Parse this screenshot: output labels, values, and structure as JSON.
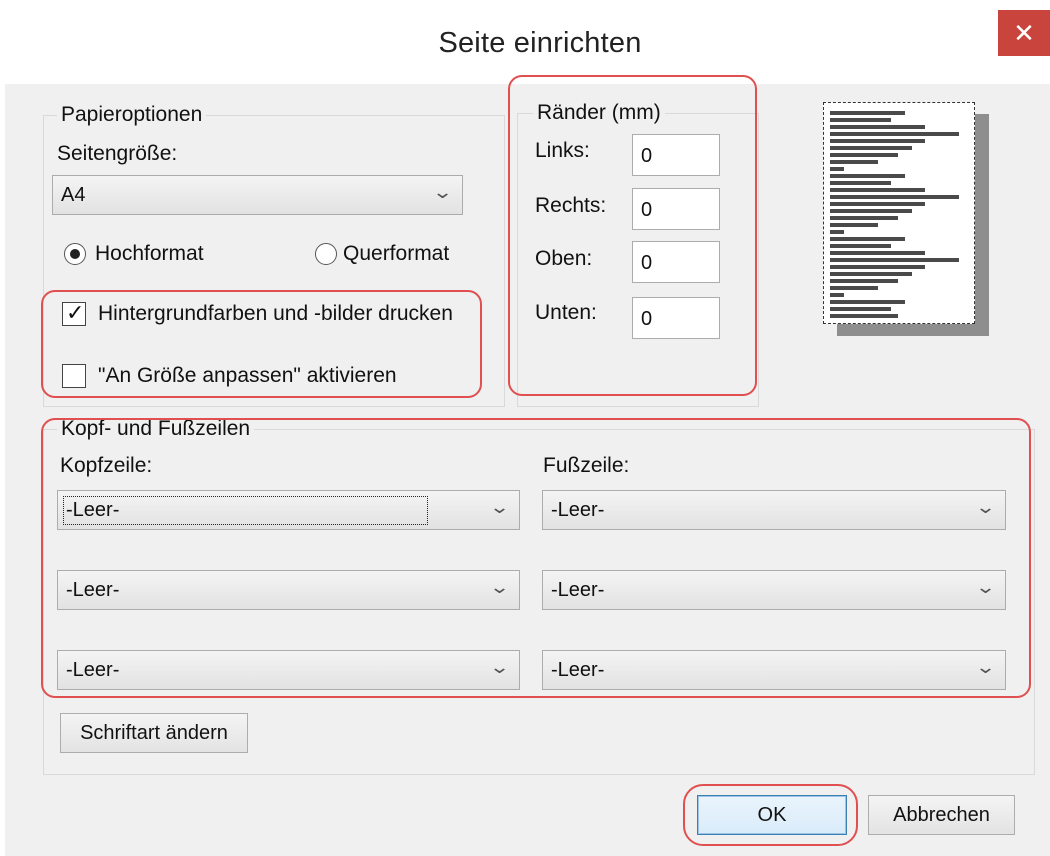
{
  "window": {
    "title": "Seite einrichten",
    "close_glyph": "✕"
  },
  "paper_options": {
    "legend": "Papieroptionen",
    "page_size_label": "Seitengröße:",
    "page_size_value": "A4",
    "portrait_label": "Hochformat",
    "landscape_label": "Querformat",
    "orientation_selected": "Hochformat",
    "print_background_label": "Hintergrundfarben und -bilder drucken",
    "print_background_checked": true,
    "shrink_to_fit_label": "\"An Größe anpassen\" aktivieren",
    "shrink_to_fit_checked": false
  },
  "margins": {
    "legend": "Ränder (mm)",
    "left_label": "Links:",
    "left_value": "0",
    "right_label": "Rechts:",
    "right_value": "0",
    "top_label": "Oben:",
    "top_value": "0",
    "bottom_label": "Unten:",
    "bottom_value": "0"
  },
  "headers_footers": {
    "legend": "Kopf- und Fußzeilen",
    "header_label": "Kopfzeile:",
    "footer_label": "Fußzeile:",
    "header_values": [
      "-Leer-",
      "-Leer-",
      "-Leer-"
    ],
    "footer_values": [
      "-Leer-",
      "-Leer-",
      "-Leer-"
    ],
    "font_button": "Schriftart ändern"
  },
  "buttons": {
    "ok": "OK",
    "cancel": "Abbrechen"
  },
  "icons": {
    "dropdown": "chevron-down-icon",
    "close": "close-icon",
    "check": "checkmark-icon"
  },
  "colors": {
    "close_bg": "#c8443c",
    "highlight": "#e05050",
    "dialog_bg": "#f0f0f0"
  }
}
